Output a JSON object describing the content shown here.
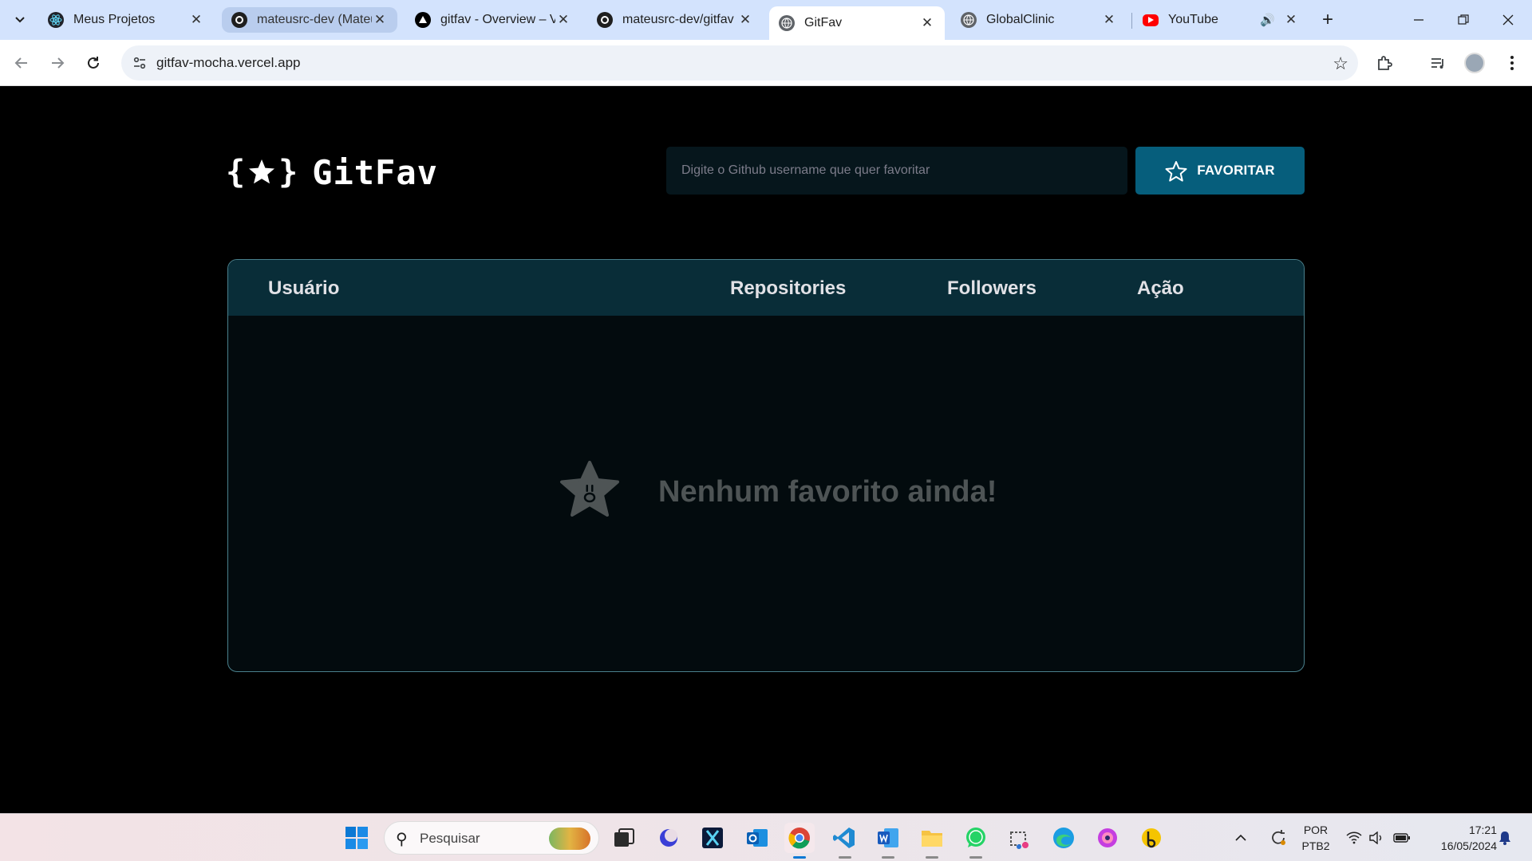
{
  "browser": {
    "tabs": [
      {
        "title": "Meus Projetos",
        "icon": "react-atom-icon"
      },
      {
        "title": "mateusrc-dev (Mateus",
        "icon": "github-icon"
      },
      {
        "title": "gitfav - Overview – V",
        "icon": "vercel-triangle-icon"
      },
      {
        "title": "mateusrc-dev/gitfav",
        "icon": "github-icon"
      },
      {
        "title": "GitFav",
        "icon": "globe-icon"
      },
      {
        "title": "GlobalClinic",
        "icon": "globe-icon"
      },
      {
        "title": "YouTube",
        "icon": "youtube-icon"
      }
    ],
    "url": "gitfav-mocha.vercel.app"
  },
  "app": {
    "logo_left": "{",
    "logo_star": "★",
    "logo_right": "}",
    "logo_name": "GitFav",
    "search_placeholder": "Digite o Github username que quer favoritar",
    "favorite_button": "FAVORITAR",
    "accent_color": "#065e7c",
    "table": {
      "headers": [
        "Usuário",
        "Repositories",
        "Followers",
        "Ação"
      ],
      "rows": [],
      "empty_message": "Nenhum favorito ainda!"
    }
  },
  "taskbar": {
    "search_label": "Pesquisar",
    "language_line1": "POR",
    "language_line2": "PTB2",
    "time": "17:21",
    "date": "16/05/2024"
  }
}
